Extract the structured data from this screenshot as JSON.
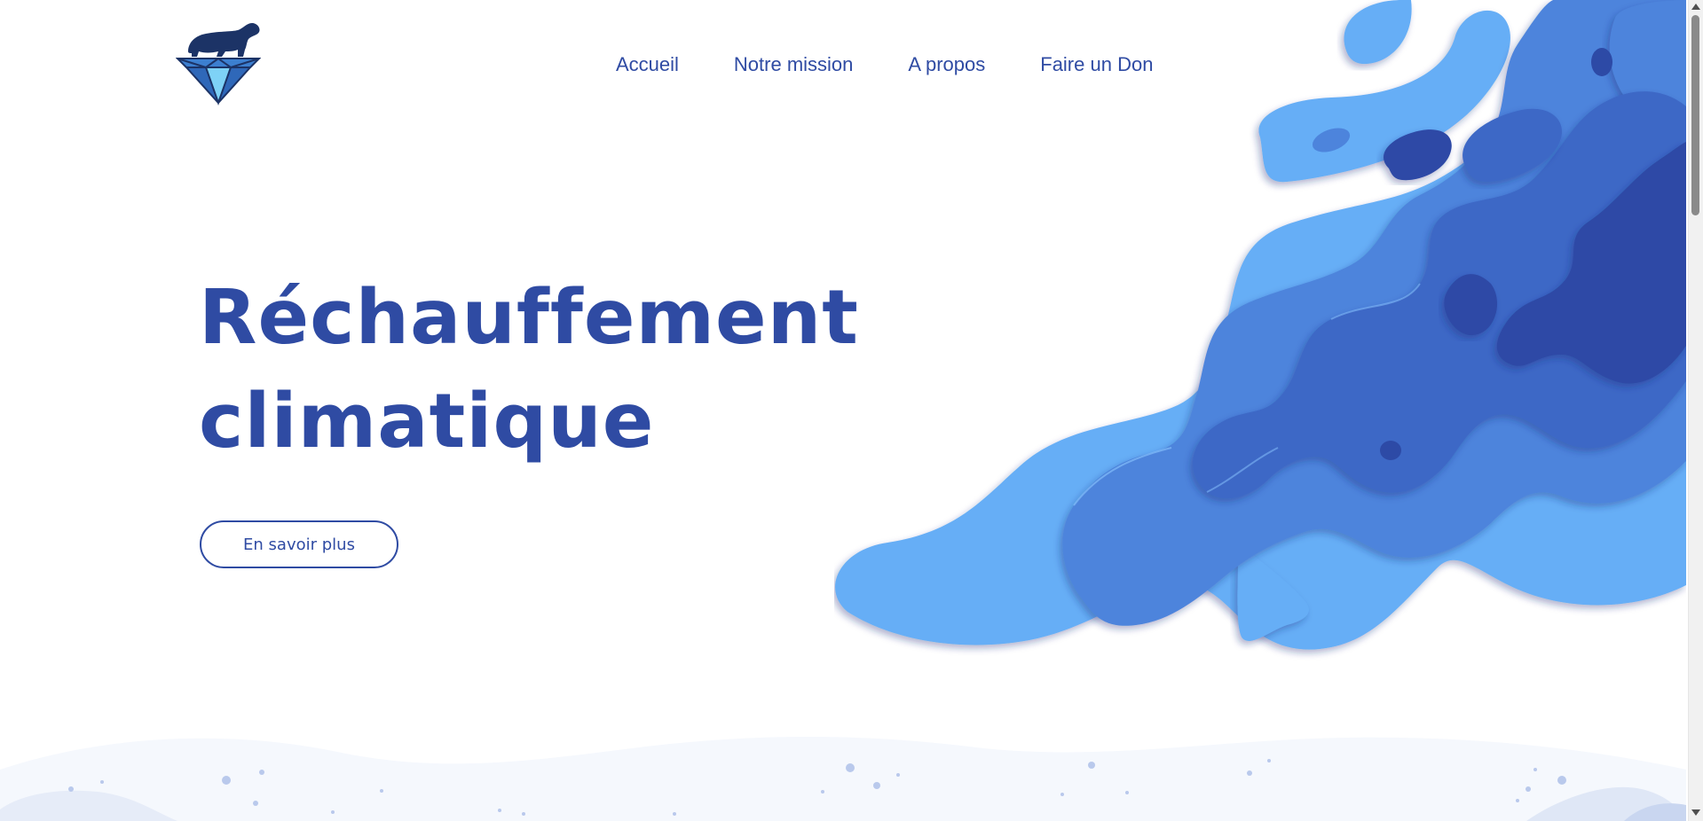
{
  "nav": {
    "items": [
      {
        "label": "Accueil"
      },
      {
        "label": "Notre mission"
      },
      {
        "label": "A propos"
      },
      {
        "label": "Faire un Don"
      }
    ]
  },
  "hero": {
    "title_line1": "Réchauffement",
    "title_line2": "climatique",
    "cta_label": "En savoir plus"
  },
  "colors": {
    "brand": "#2f4ba3",
    "light_blue": "#63aef6",
    "mid_blue": "#4a7fd6",
    "dark_blue": "#2c49a3"
  },
  "icons": {
    "logo": "polar-bear-on-iceberg-logo"
  }
}
